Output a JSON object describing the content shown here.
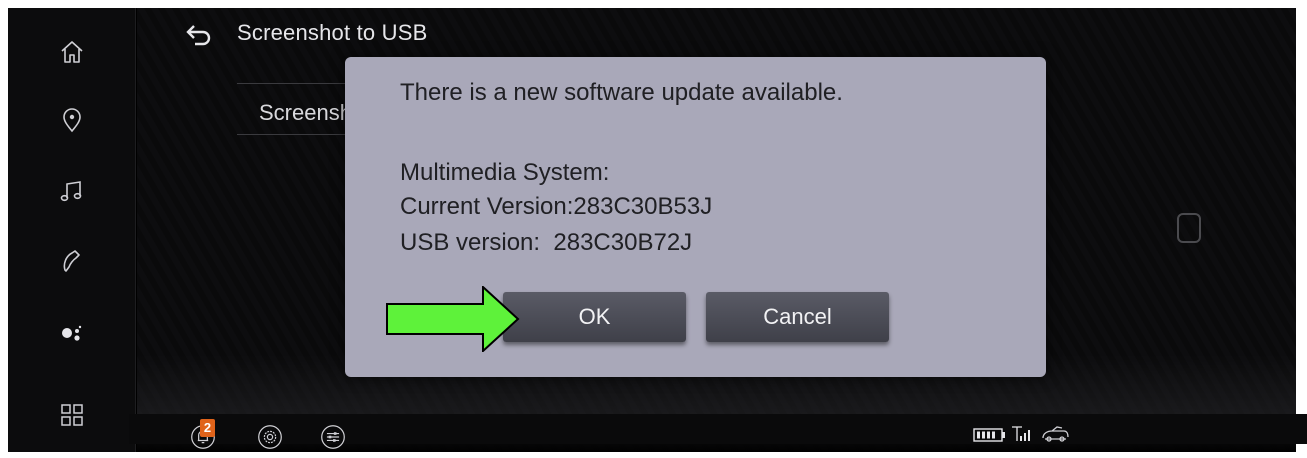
{
  "header": {
    "title": "Screenshot to USB"
  },
  "list": {
    "item_label": "Screenshot to USB"
  },
  "sidebar": {
    "items": [
      {
        "icon": "home-icon"
      },
      {
        "icon": "map-pin-icon"
      },
      {
        "icon": "music-icon"
      },
      {
        "icon": "phone-icon"
      },
      {
        "icon": "voice-assistant-icon"
      },
      {
        "icon": "apps-grid-icon"
      }
    ]
  },
  "status_bar": {
    "notification_count": "2",
    "icons": [
      "notification-bell-icon",
      "settings-gear-icon",
      "audio-settings-icon",
      "battery-icon",
      "signal-icon",
      "vehicle-icon"
    ]
  },
  "dialog": {
    "message": "There is a new software update available.",
    "system_label": "Multimedia System:",
    "current_version": "Current Version:283C30B53J",
    "usb_version": "USB version:  283C30B72J",
    "ok_label": "OK",
    "cancel_label": "Cancel"
  },
  "annotation": {
    "arrow_color": "#5ef23a"
  },
  "colors": {
    "dialog_bg": "#a9a8b9",
    "button_bg": "#4b4c56",
    "screen_bg": "#000000"
  }
}
